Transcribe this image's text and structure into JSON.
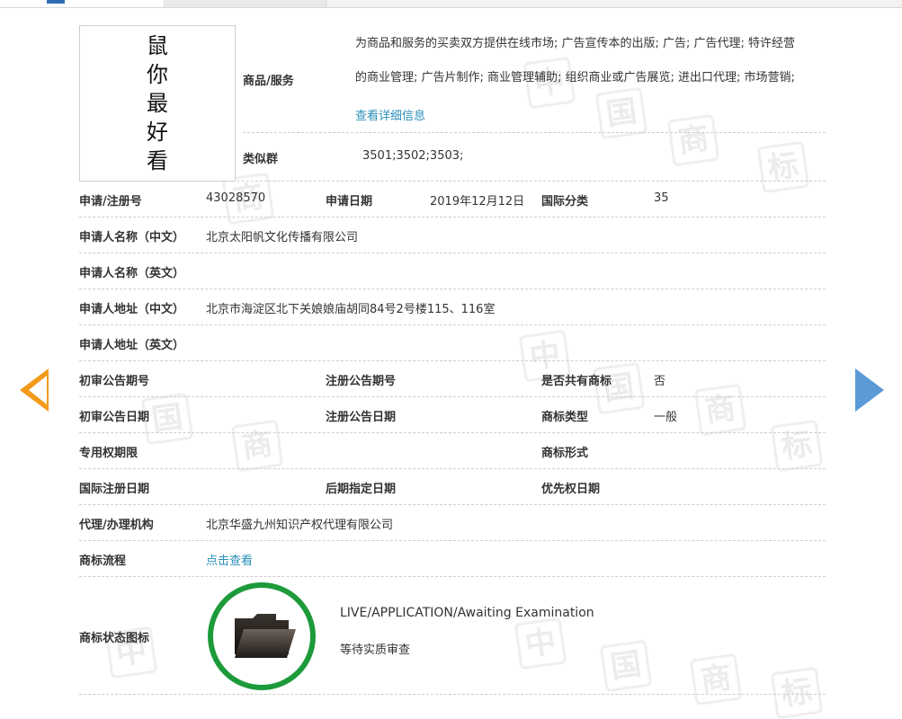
{
  "logo": {
    "chars": [
      "鼠",
      "你",
      "最",
      "好",
      "看"
    ]
  },
  "goods_services": {
    "label": "商品/服务",
    "lines": [
      "为商品和服务的买卖双方提供在线市场; 广告宣传本的出版; 广告; 广告代理; 特许经营",
      "的商业管理; 广告片制作; 商业管理辅助; 组织商业或广告展览; 进出口代理; 市场营销;"
    ],
    "more_link": "查看详细信息"
  },
  "similar_group": {
    "label": "类似群",
    "value": "3501;3502;3503;"
  },
  "application_no": {
    "label": "申请/注册号",
    "value": "43028570"
  },
  "application_date": {
    "label": "申请日期",
    "value": "2019年12月12日"
  },
  "intl_class": {
    "label": "国际分类",
    "value": "35"
  },
  "applicant_name_cn": {
    "label": "申请人名称（中文）",
    "value": "北京太阳帆文化传播有限公司"
  },
  "applicant_name_en": {
    "label": "申请人名称（英文）",
    "value": ""
  },
  "applicant_addr_cn": {
    "label": "申请人地址（中文）",
    "value": "北京市海淀区北下关娘娘庙胡同84号2号楼115、116室"
  },
  "applicant_addr_en": {
    "label": "申请人地址（英文）",
    "value": ""
  },
  "prelim_pub_no": {
    "label": "初审公告期号",
    "value": ""
  },
  "reg_pub_no": {
    "label": "注册公告期号",
    "value": ""
  },
  "shared_mark": {
    "label": "是否共有商标",
    "value": "否"
  },
  "prelim_pub_date": {
    "label": "初审公告日期",
    "value": ""
  },
  "reg_pub_date": {
    "label": "注册公告日期",
    "value": ""
  },
  "mark_type": {
    "label": "商标类型",
    "value": "一般"
  },
  "exclusive_period": {
    "label": "专用权期限",
    "value": ""
  },
  "mark_form": {
    "label": "商标形式",
    "value": ""
  },
  "intl_reg_date": {
    "label": "国际注册日期",
    "value": ""
  },
  "later_designation_date": {
    "label": "后期指定日期",
    "value": ""
  },
  "priority_date": {
    "label": "优先权日期",
    "value": ""
  },
  "agent": {
    "label": "代理/办理机构",
    "value": "北京华盛九州知识产权代理有限公司"
  },
  "process": {
    "label": "商标流程",
    "link": "点击查看"
  },
  "status": {
    "label": "商标状态图标",
    "line1": "LIVE/APPLICATION/Awaiting Examination",
    "line2": "等待实质审查",
    "icon": "folder-icon",
    "ring_color": "#1d9a3a"
  },
  "colors": {
    "link": "#2a8fb8",
    "prev_arrow": "#f39a1b",
    "next_arrow": "#5b9ad6"
  }
}
